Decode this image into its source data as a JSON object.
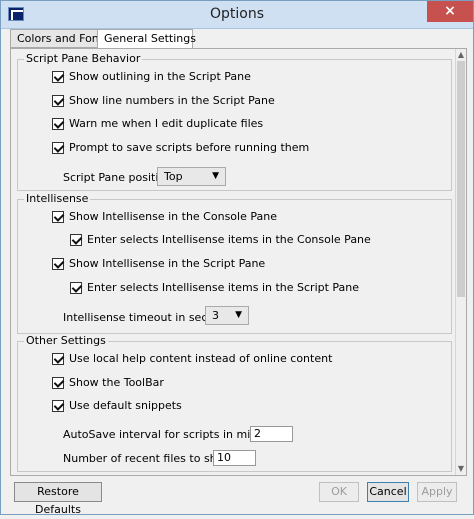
{
  "window": {
    "title": "Options",
    "close_glyph": "×",
    "app_icon": "powershell-ise-icon"
  },
  "tabs": [
    {
      "label": "Colors and Fonts",
      "active": false
    },
    {
      "label": "General Settings",
      "active": true
    }
  ],
  "script_pane_behavior": {
    "title": "Script Pane Behavior",
    "options": [
      {
        "label": "Show outlining in the Script Pane",
        "checked": true
      },
      {
        "label": "Show line numbers in the Script Pane",
        "checked": true
      },
      {
        "label": "Warn me when I edit duplicate files",
        "checked": true
      },
      {
        "label": "Prompt to save scripts before running them",
        "checked": true
      }
    ],
    "position_label": "Script Pane position:",
    "position_value": "Top"
  },
  "intellisense": {
    "title": "Intellisense",
    "console": {
      "label": "Show Intellisense in the Console Pane",
      "checked": true
    },
    "console_enter": {
      "label": "Enter selects Intellisense items in the Console Pane",
      "checked": true
    },
    "script": {
      "label": "Show Intellisense in the Script Pane",
      "checked": true
    },
    "script_enter": {
      "label": "Enter selects Intellisense items in the Script Pane",
      "checked": true
    },
    "timeout_label": "Intellisense timeout in seconds:",
    "timeout_value": "3"
  },
  "other_settings": {
    "title": "Other Settings",
    "options": [
      {
        "label": "Use local help content instead of online content",
        "checked": true
      },
      {
        "label": "Show the ToolBar",
        "checked": true
      },
      {
        "label": "Use default snippets",
        "checked": true
      }
    ],
    "autosave_label": "AutoSave interval for scripts in minutes:",
    "autosave_value": "2",
    "recent_label": "Number of recent files to show:",
    "recent_value": "10"
  },
  "buttons": {
    "restore": "Restore Defaults",
    "ok": "OK",
    "cancel": "Cancel",
    "apply": "Apply"
  }
}
